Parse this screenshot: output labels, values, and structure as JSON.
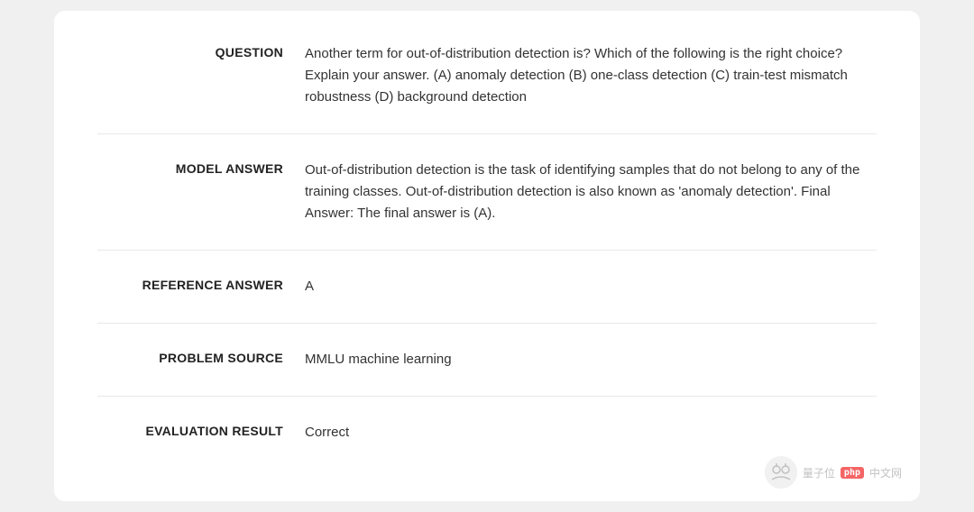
{
  "card": {
    "rows": [
      {
        "id": "question",
        "label": "QUESTION",
        "value": "Another term for out-of-distribution detection is? Which of the following is the right choice? Explain your answer. (A) anomaly detection (B) one-class detection (C) train-test mismatch robustness (D) background detection"
      },
      {
        "id": "model-answer",
        "label": "MODEL ANSWER",
        "value": "Out-of-distribution detection is the task of identifying samples that do not belong to any of the training classes. Out-of-distribution detection is also known as 'anomaly detection'. Final Answer: The final answer is (A)."
      },
      {
        "id": "reference-answer",
        "label": "REFERENCE ANSWER",
        "value": "A"
      },
      {
        "id": "problem-source",
        "label": "PROBLEM SOURCE",
        "value": "MMLU machine learning"
      },
      {
        "id": "evaluation-result",
        "label": "EVALUATION RESULT",
        "value": "Correct"
      }
    ],
    "watermark": {
      "logo_text": "量子位",
      "php_label": "php",
      "site_label": "中文网"
    }
  }
}
